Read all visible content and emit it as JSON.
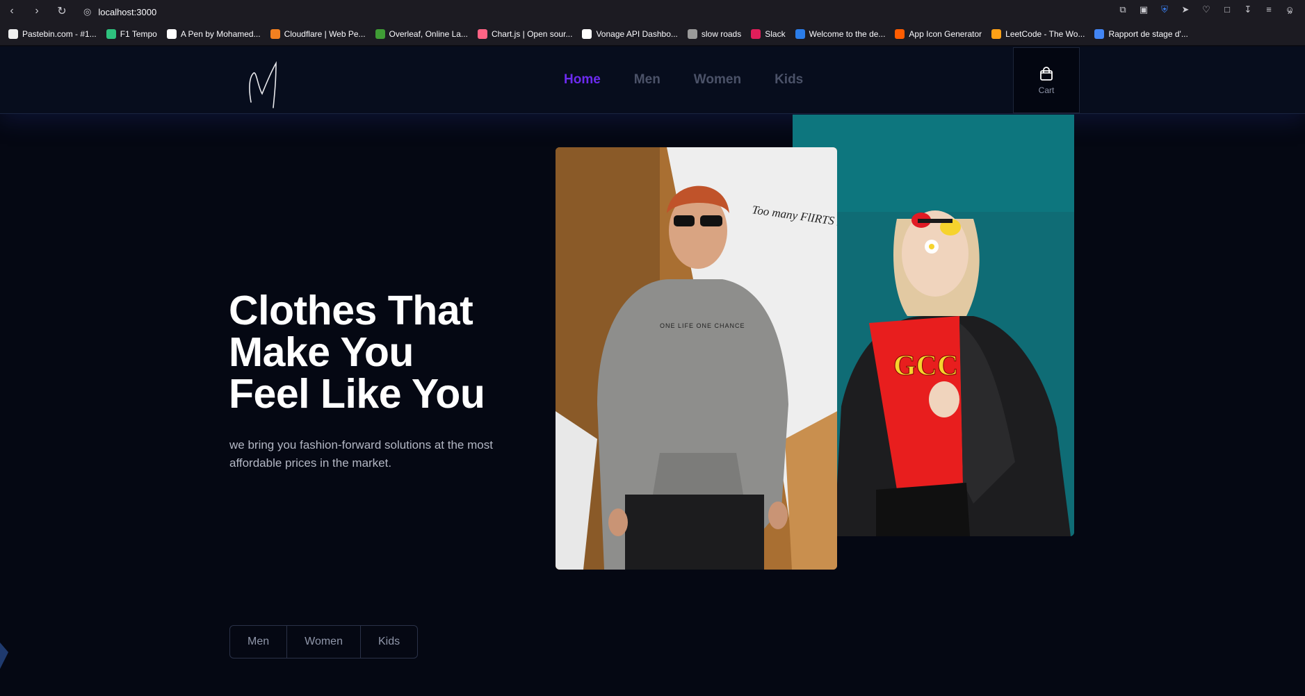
{
  "browser": {
    "url": "localhost:3000",
    "bookmarks": [
      {
        "label": "Pastebin.com - #1...",
        "color": "#f0f0f0"
      },
      {
        "label": "F1 Tempo",
        "color": "#2ec27e"
      },
      {
        "label": "A Pen by Mohamed...",
        "color": "#ffffff"
      },
      {
        "label": "Cloudflare | Web Pe...",
        "color": "#f38020"
      },
      {
        "label": "Overleaf, Online La...",
        "color": "#3f9c35"
      },
      {
        "label": "Chart.js | Open sour...",
        "color": "#ff6384"
      },
      {
        "label": "Vonage API Dashbo...",
        "color": "#ffffff"
      },
      {
        "label": "slow roads",
        "color": "#9a9a9a"
      },
      {
        "label": "Slack",
        "color": "#e01e5a"
      },
      {
        "label": "Welcome to the de...",
        "color": "#2b7de9"
      },
      {
        "label": "App Icon Generator",
        "color": "#ff5c00"
      },
      {
        "label": "LeetCode - The Wo...",
        "color": "#ffa116"
      },
      {
        "label": "Rapport de stage d'...",
        "color": "#4285f4"
      }
    ]
  },
  "header": {
    "nav": [
      "Home",
      "Men",
      "Women",
      "Kids"
    ],
    "active": "Home",
    "cart_label": "Cart"
  },
  "hero": {
    "title_line1": "Clothes That",
    "title_line2": "Make You",
    "title_line3": "Feel Like You",
    "subtitle": "we bring you fashion-forward solutions at the most affordable prices in the market.",
    "photo1_text": "Too many FlIRTS In MINI SKIRT",
    "hoodie_text": "ONE LIFE ONE CHANCE",
    "shirt_text": "GCC"
  },
  "filters": [
    "Men",
    "Women",
    "Kids"
  ],
  "colors": {
    "accent": "#6c2bf0",
    "background": "#050813",
    "teal": "#0e6b73"
  }
}
